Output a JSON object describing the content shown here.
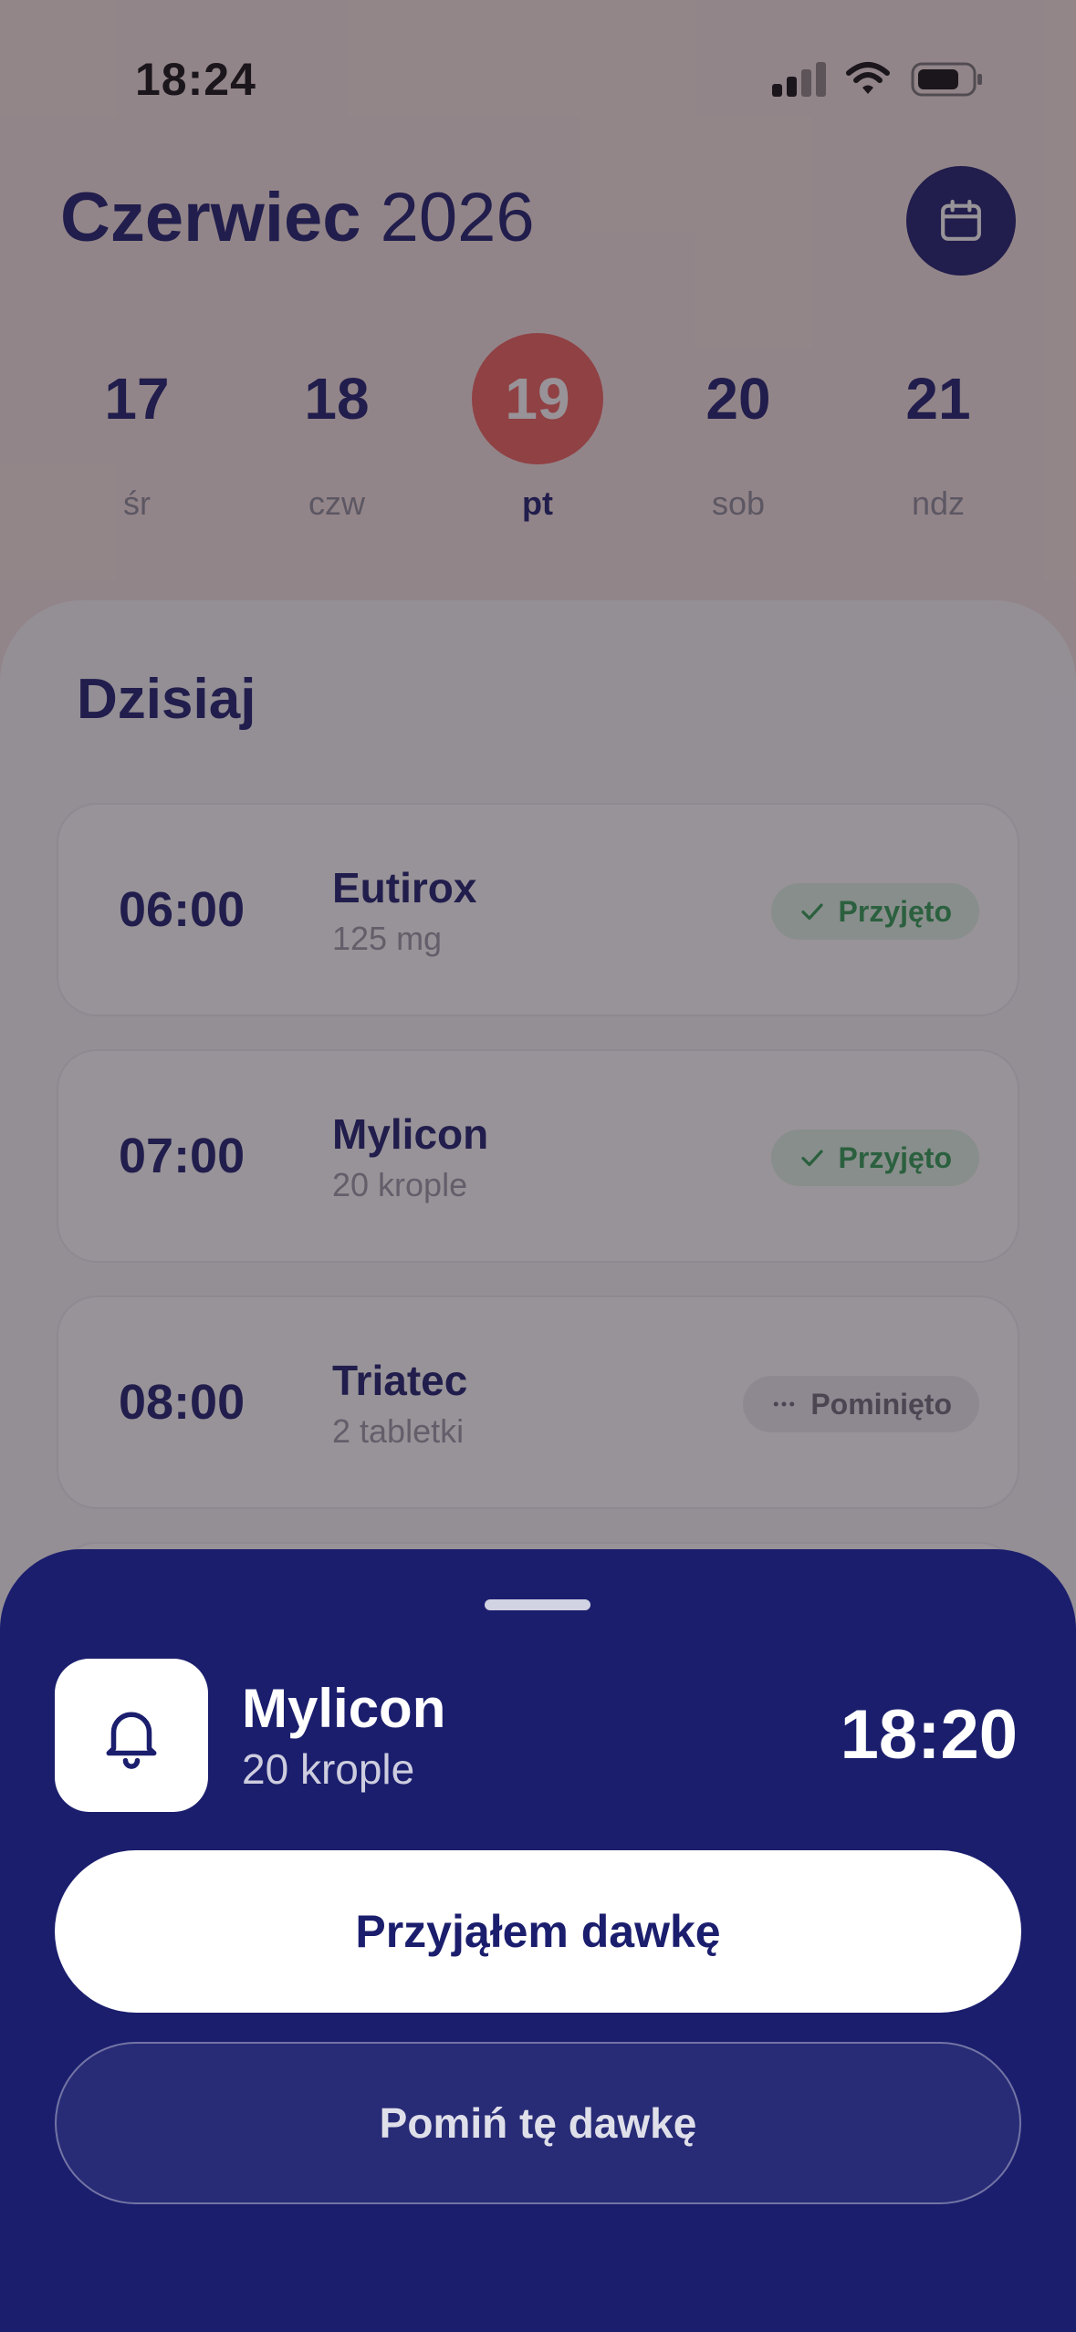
{
  "status_bar": {
    "time": "18:24"
  },
  "header": {
    "month": "Czerwiec",
    "year": "2026",
    "calendar_icon": "calendar-icon"
  },
  "week": [
    {
      "num": "17",
      "label": "śr"
    },
    {
      "num": "18",
      "label": "czw"
    },
    {
      "num": "19",
      "label": "pt",
      "selected": true
    },
    {
      "num": "20",
      "label": "sob"
    },
    {
      "num": "21",
      "label": "ndz"
    }
  ],
  "today": {
    "title": "Dzisiaj",
    "doses": [
      {
        "time": "06:00",
        "name": "Eutirox",
        "amount": "125 mg",
        "status": "Przyjęto",
        "status_type": "taken"
      },
      {
        "time": "07:00",
        "name": "Mylicon",
        "amount": "20 krople",
        "status": "Przyjęto",
        "status_type": "taken"
      },
      {
        "time": "08:00",
        "name": "Triatec",
        "amount": "2 tabletki",
        "status": "Pominięto",
        "status_type": "skipped"
      }
    ]
  },
  "sheet": {
    "icon": "bell-icon",
    "name": "Mylicon",
    "amount": "20 krople",
    "time": "18:20",
    "primary_label": "Przyjąłem dawkę",
    "secondary_label": "Pomiń tę dawkę"
  },
  "colors": {
    "navy": "#1b1e6d",
    "accent_red": "#f0635e",
    "taken_green": "#2f9e55",
    "header_bg": "#f3e5e2"
  }
}
